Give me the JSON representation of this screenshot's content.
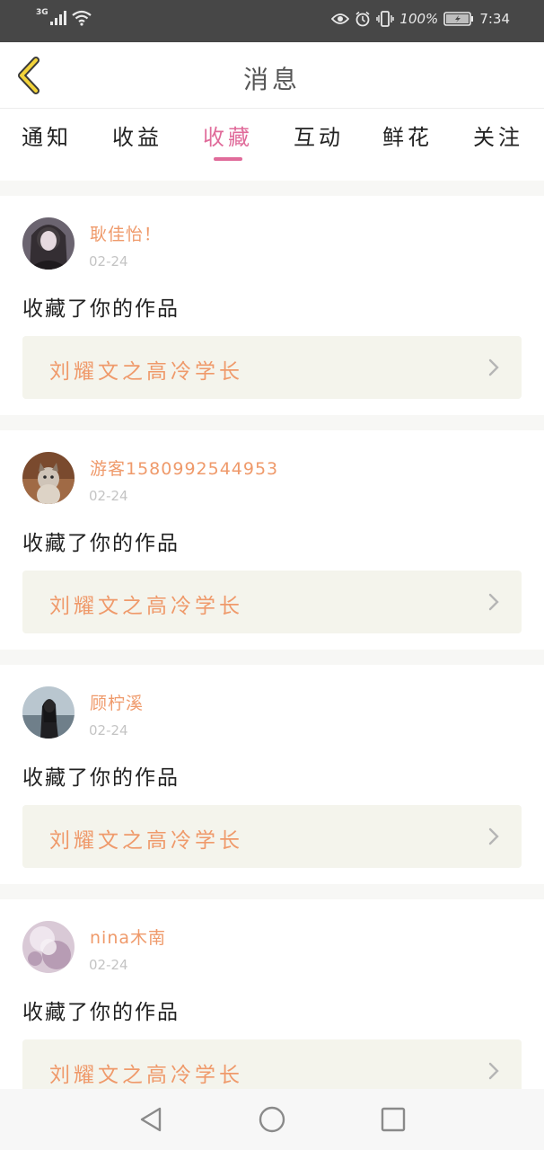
{
  "status_bar": {
    "network": "3G",
    "battery_percent": "100%",
    "time": "7:34",
    "icons": [
      "signal-icon",
      "wifi-icon",
      "eye-icon",
      "alarm-icon",
      "vibrate-icon",
      "battery-icon"
    ]
  },
  "header": {
    "title": "消息",
    "back_icon": "chevron-left-icon"
  },
  "tabs": {
    "items": [
      {
        "label": "通知"
      },
      {
        "label": "收益"
      },
      {
        "label": "收藏"
      },
      {
        "label": "互动"
      },
      {
        "label": "鲜花"
      },
      {
        "label": "关注"
      }
    ],
    "active": "收藏"
  },
  "messages": [
    {
      "user": "耿佳怡！",
      "date": "02-24",
      "action": "收藏了你的作品",
      "work_title": "刘耀文之高冷学长"
    },
    {
      "user": "游客1580992544953",
      "date": "02-24",
      "action": "收藏了你的作品",
      "work_title": "刘耀文之高冷学长"
    },
    {
      "user": "顾柠溪",
      "date": "02-24",
      "action": "收藏了你的作品",
      "work_title": "刘耀文之高冷学长"
    },
    {
      "user": "nina木南",
      "date": "02-24",
      "action": "收藏了你的作品",
      "work_title": "刘耀文之高冷学长"
    }
  ],
  "colors": {
    "accent_pink": "#e06b9a",
    "username_orange": "#ef9a6b",
    "back_icon_yellow": "#f2d33a",
    "link_bg": "#f4f4ec"
  },
  "nav_bar": {
    "icons": [
      "back-triangle-icon",
      "home-circle-icon",
      "recents-square-icon"
    ]
  }
}
